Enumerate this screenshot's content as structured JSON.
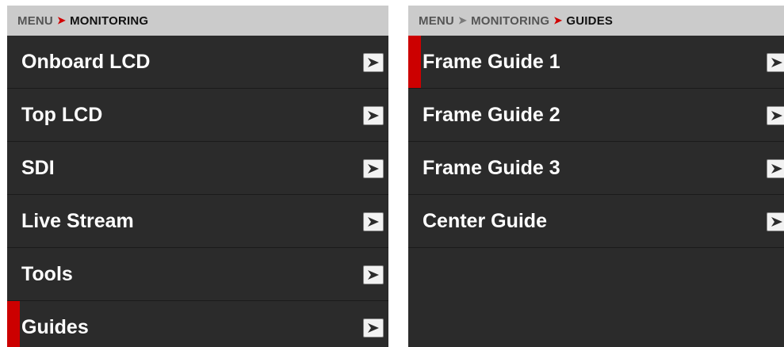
{
  "left_panel": {
    "breadcrumb": [
      {
        "label": "MENU"
      },
      {
        "label": "MONITORING"
      }
    ],
    "items": [
      {
        "label": "Onboard LCD",
        "selected": false
      },
      {
        "label": "Top LCD",
        "selected": false
      },
      {
        "label": "SDI",
        "selected": false
      },
      {
        "label": "Live Stream",
        "selected": false
      },
      {
        "label": "Tools",
        "selected": false
      },
      {
        "label": "Guides",
        "selected": true
      }
    ]
  },
  "right_panel": {
    "breadcrumb": [
      {
        "label": "MENU"
      },
      {
        "label": "MONITORING"
      },
      {
        "label": "GUIDES"
      }
    ],
    "items": [
      {
        "label": "Frame Guide 1",
        "selected": true
      },
      {
        "label": "Frame Guide 2",
        "selected": false
      },
      {
        "label": "Frame Guide 3",
        "selected": false
      },
      {
        "label": "Center Guide",
        "selected": false
      }
    ]
  },
  "colors": {
    "accent": "#cc0000",
    "panel_bg": "#2b2b2b",
    "breadcrumb_bg": "#cbcbcb"
  },
  "icons": {
    "breadcrumb_separator": "triangle-right-icon",
    "row_arrow": "chevron-arrow-right-icon"
  }
}
